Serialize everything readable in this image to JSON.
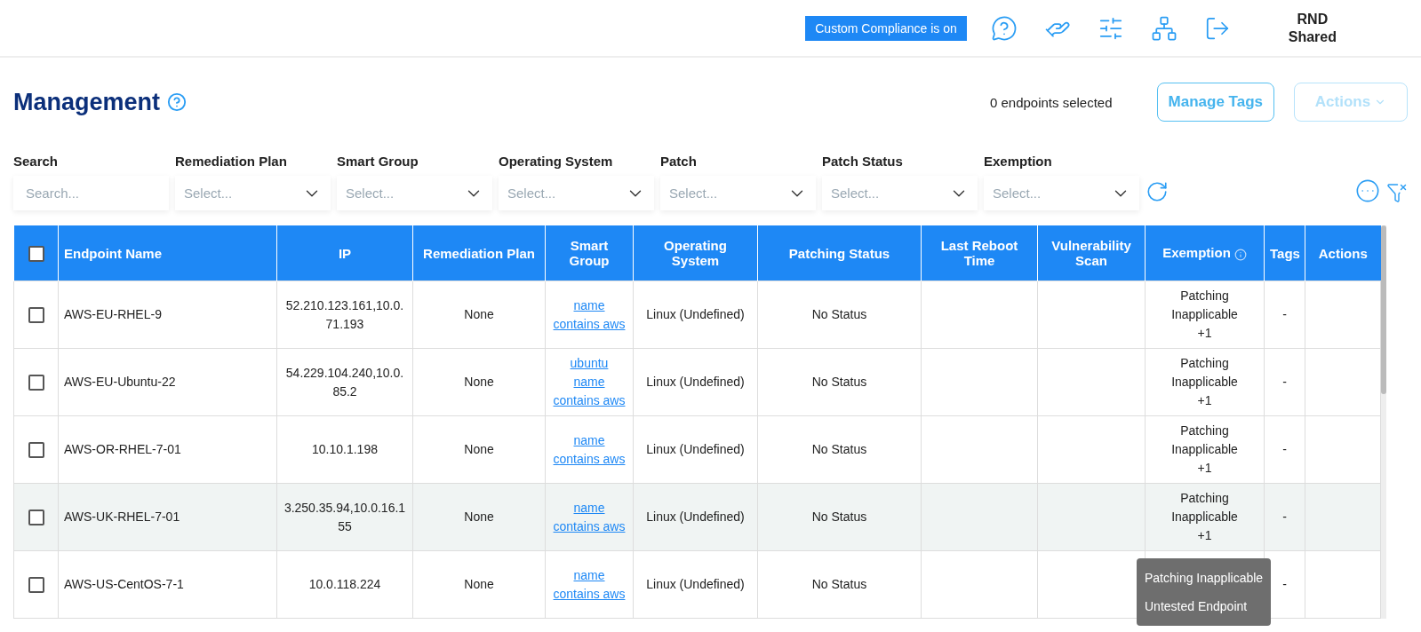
{
  "topbar": {
    "badge": "Custom Compliance is on",
    "user": [
      "RND",
      "Shared"
    ]
  },
  "header": {
    "title": "Management",
    "selected_count": "0 endpoints selected",
    "buttons": [
      {
        "label": "Manage Tags",
        "disabled": false
      },
      {
        "label": "Actions",
        "disabled": true
      }
    ]
  },
  "filters": [
    {
      "kind": "search",
      "label": "Search",
      "placeholder": "Search..."
    },
    {
      "kind": "select",
      "label": "Remediation Plan",
      "placeholder": "Select..."
    },
    {
      "kind": "select",
      "label": "Smart Group",
      "placeholder": "Select..."
    },
    {
      "kind": "select",
      "label": "Operating System",
      "placeholder": "Select..."
    },
    {
      "kind": "select",
      "label": "Patch",
      "placeholder": "Select..."
    },
    {
      "kind": "select",
      "label": "Patch Status",
      "placeholder": "Select..."
    },
    {
      "kind": "select",
      "label": "Exemption",
      "placeholder": "Select..."
    }
  ],
  "table": {
    "select_all_checked": false,
    "columns": [
      "Endpoint Name",
      "IP",
      "Remediation Plan",
      "Smart Group",
      "Operating System",
      "Patching Status",
      "Last Reboot Time",
      "Vulnerability Scan",
      "Exemption",
      "Tags",
      "Actions"
    ],
    "rows": [
      {
        "checked": false,
        "highlighted": false,
        "name": "AWS-EU-RHEL-9",
        "ip": "52.210.123.161,10.0.71.193",
        "remediation": "None",
        "smart_groups": [
          "name contains aws"
        ],
        "os": "Linux (Undefined)",
        "patching_status": "No Status",
        "exemption": "Patching Inapplicable",
        "exemption_more": "+1",
        "tags": "-"
      },
      {
        "checked": false,
        "highlighted": false,
        "name": "AWS-EU-Ubuntu-22",
        "ip": "54.229.104.240,10.0.85.2",
        "remediation": "None",
        "smart_groups": [
          "ubuntu",
          "name contains aws"
        ],
        "os": "Linux (Undefined)",
        "patching_status": "No Status",
        "exemption": "Patching Inapplicable",
        "exemption_more": "+1",
        "tags": "-"
      },
      {
        "checked": false,
        "highlighted": false,
        "name": "AWS-OR-RHEL-7-01",
        "ip": "10.10.1.198",
        "remediation": "None",
        "smart_groups": [
          "name contains aws"
        ],
        "os": "Linux (Undefined)",
        "patching_status": "No Status",
        "exemption": "Patching Inapplicable",
        "exemption_more": "+1",
        "tags": "-"
      },
      {
        "checked": false,
        "highlighted": true,
        "name": "AWS-UK-RHEL-7-01",
        "ip": "3.250.35.94,10.0.16.155",
        "remediation": "None",
        "smart_groups": [
          "name contains aws"
        ],
        "os": "Linux (Undefined)",
        "patching_status": "No Status",
        "exemption": "Patching Inapplicable",
        "exemption_more": "+1",
        "tags": "-"
      },
      {
        "checked": false,
        "highlighted": false,
        "name": "AWS-US-CentOS-7-1",
        "ip": "10.0.118.224",
        "remediation": "None",
        "smart_groups": [
          "name contains aws"
        ],
        "os": "Linux (Undefined)",
        "patching_status": "No Status",
        "tags": "-",
        "tooltip": [
          "Patching Inapplicable",
          "Untested Endpoint"
        ]
      }
    ]
  }
}
